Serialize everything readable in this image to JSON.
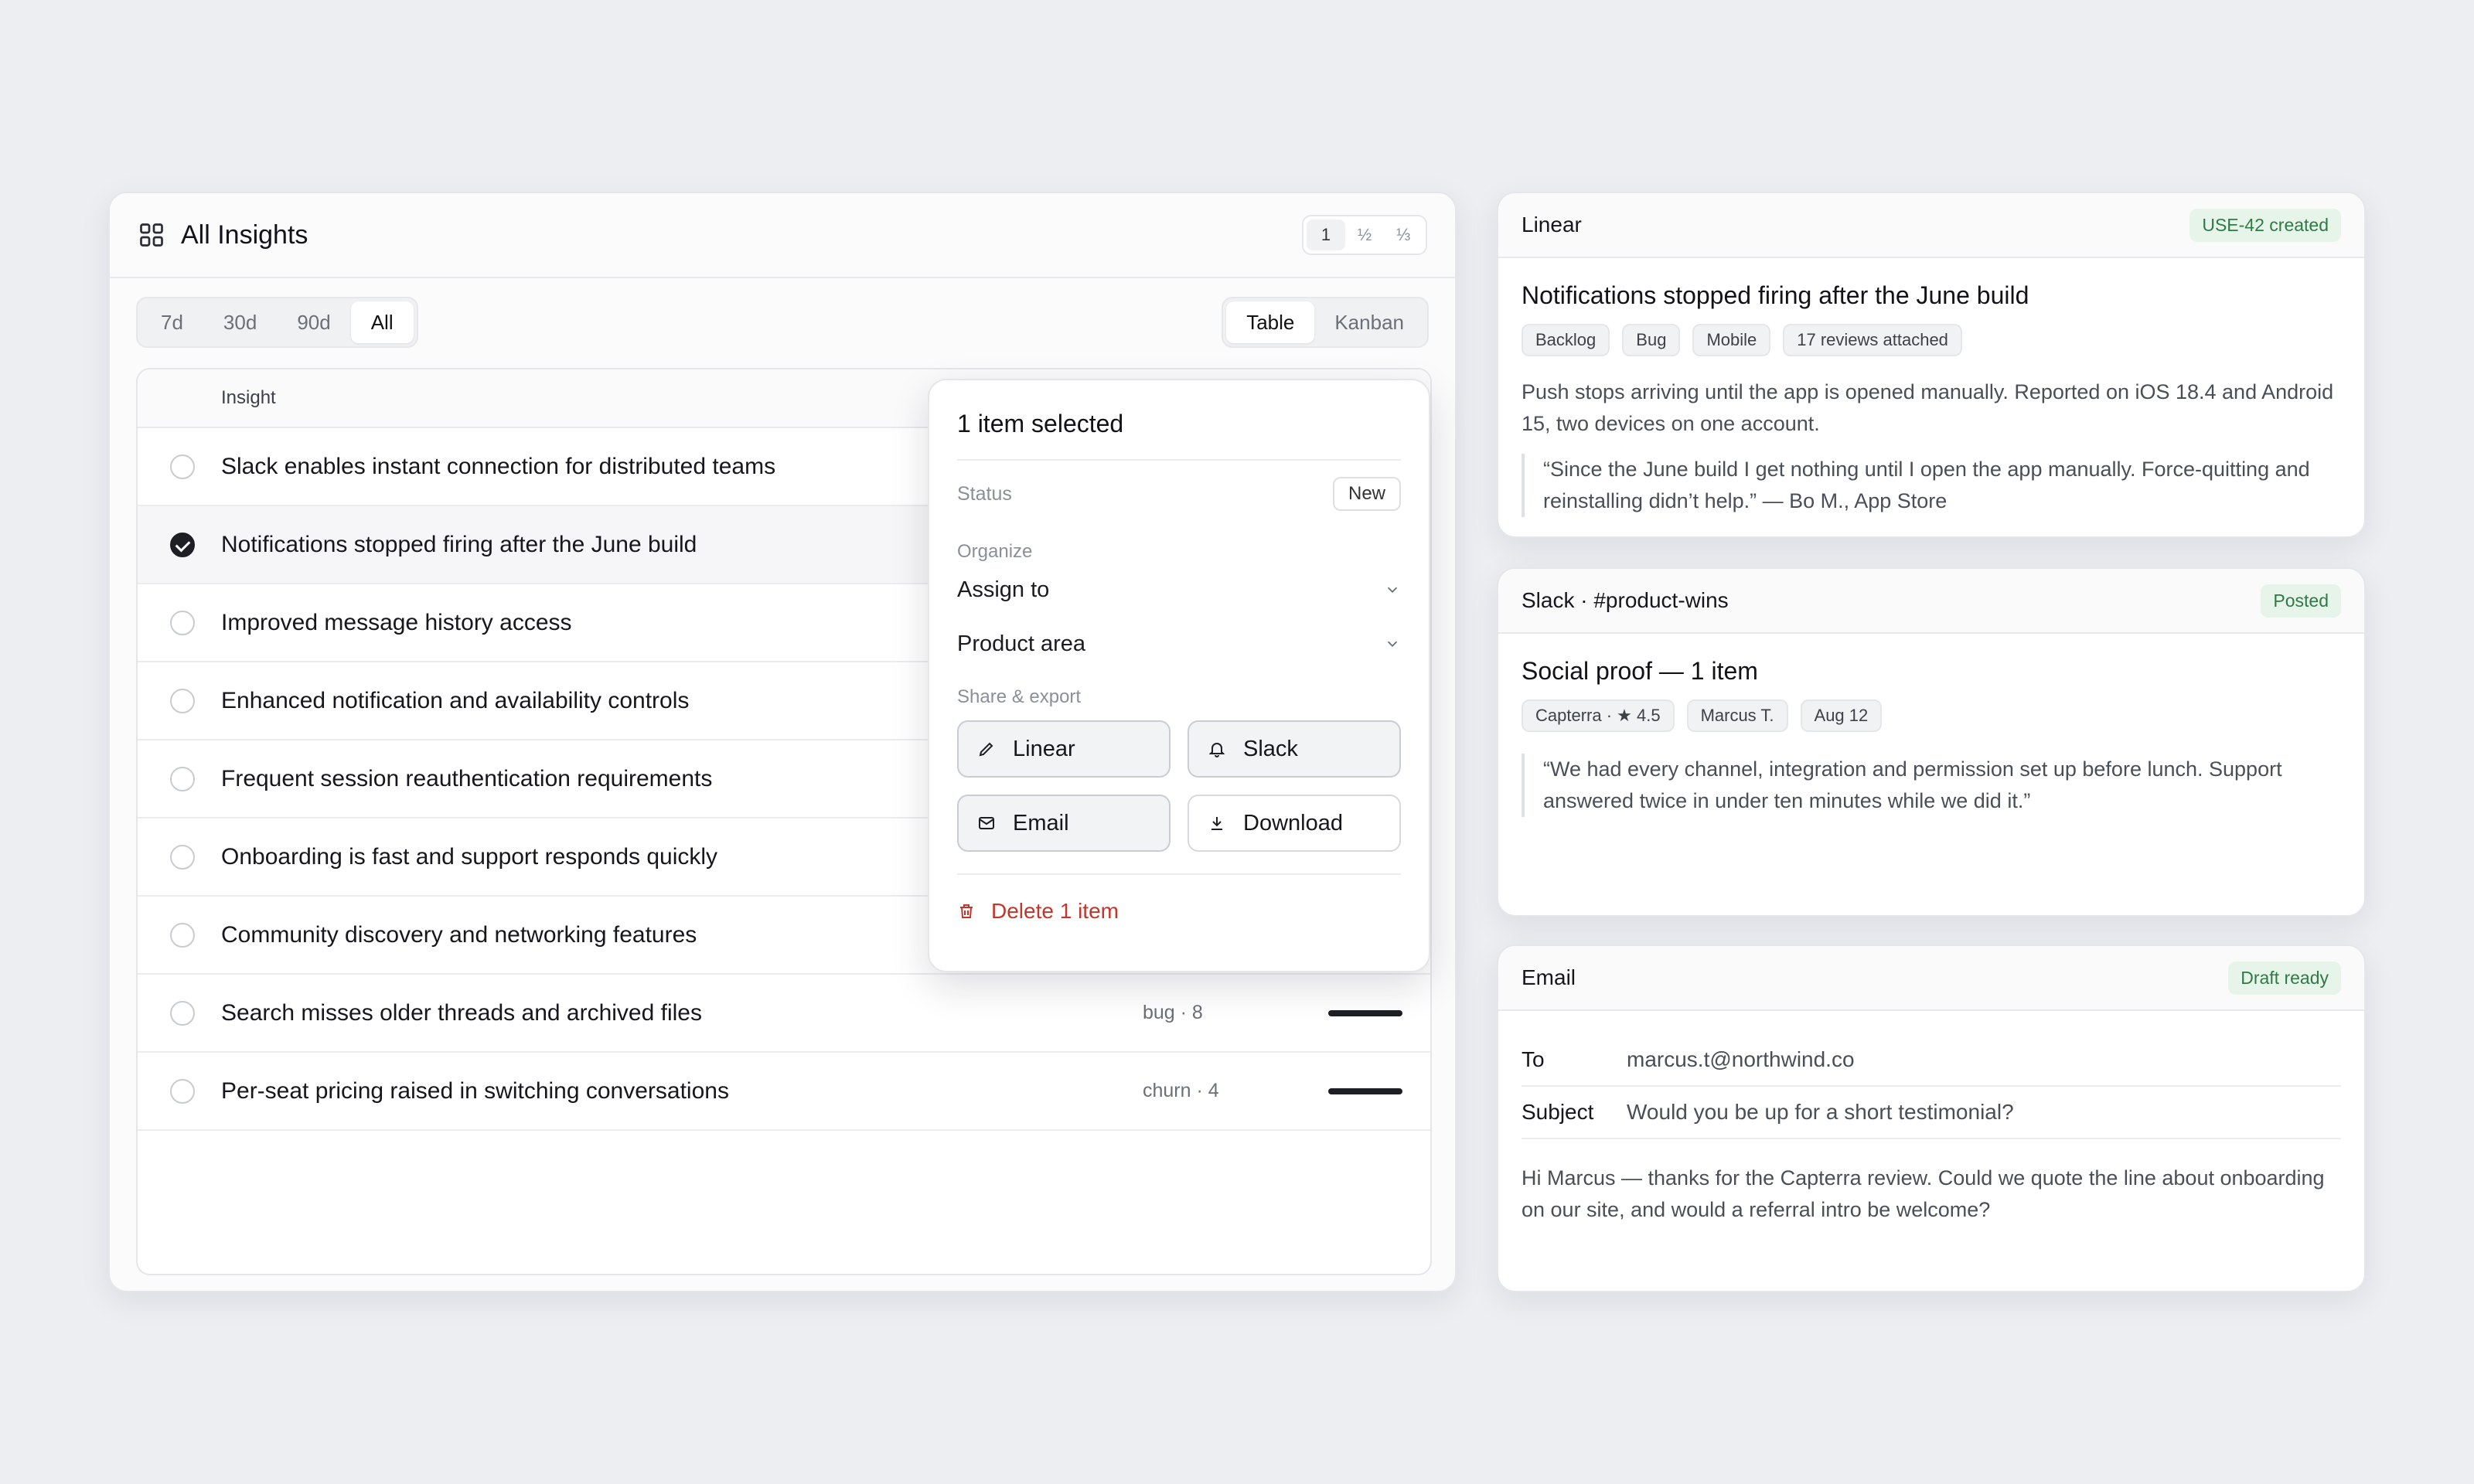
{
  "insights": {
    "title": "All Insights",
    "density_options": [
      "1",
      "½",
      "⅓"
    ],
    "density_selected": "1",
    "time_ranges": [
      "7d",
      "30d",
      "90d",
      "All"
    ],
    "time_selected": "All",
    "views": [
      "Table",
      "Kanban"
    ],
    "view_selected": "Table",
    "column_header": "Insight",
    "rows": [
      {
        "label": "Slack enables instant connection for distributed teams",
        "selected": false,
        "tag": "",
        "bar": false
      },
      {
        "label": "Notifications stopped firing after the June build",
        "selected": true,
        "tag": "",
        "bar": false
      },
      {
        "label": "Improved message history access",
        "selected": false,
        "tag": "",
        "bar": false
      },
      {
        "label": "Enhanced notification and availability controls",
        "selected": false,
        "tag": "",
        "bar": false
      },
      {
        "label": "Frequent session reauthentication requirements",
        "selected": false,
        "tag": "",
        "bar": false
      },
      {
        "label": "Onboarding is fast and support responds quickly",
        "selected": false,
        "tag": "",
        "bar": false
      },
      {
        "label": "Community discovery and networking features",
        "selected": false,
        "tag": "",
        "bar": false
      },
      {
        "label": "Search misses older threads and archived files",
        "selected": false,
        "tag": "bug · 8",
        "bar": true
      },
      {
        "label": "Per-seat pricing raised in switching conversations",
        "selected": false,
        "tag": "churn · 4",
        "bar": true
      }
    ]
  },
  "popover": {
    "title": "1 item selected",
    "status_label": "Status",
    "status_value": "New",
    "organize_label": "Organize",
    "assign_label": "Assign to",
    "area_label": "Product area",
    "share_label": "Share & export",
    "buttons": {
      "linear": "Linear",
      "slack": "Slack",
      "email": "Email",
      "download": "Download"
    },
    "delete_label": "Delete 1 item"
  },
  "linear_card": {
    "source": "Linear",
    "badge": "USE-42 created",
    "title": "Notifications stopped firing after the June build",
    "chips": [
      "Backlog",
      "Bug",
      "Mobile",
      "17 reviews attached"
    ],
    "description": "Push stops arriving until the app is opened manually. Reported on iOS 18.4 and Android 15, two devices on one account.",
    "quote": "“Since the June build I get nothing until I open the app manually. Force-quitting and reinstalling didn’t help.” — Bo M., App Store"
  },
  "slack_card": {
    "source": "Slack · #product-wins",
    "badge": "Posted",
    "title": "Social proof — 1 item",
    "chips": [
      "Capterra · ★ 4.5",
      "Marcus T.",
      "Aug 12"
    ],
    "quote": "“We had every channel, integration and permission set up before lunch. Support answered twice in under ten minutes while we did it.”"
  },
  "email_card": {
    "source": "Email",
    "badge": "Draft ready",
    "to_label": "To",
    "to_value": "marcus.t@northwind.co",
    "subject_label": "Subject",
    "subject_value": "Would you be up for a short testimonial?",
    "body": "Hi Marcus — thanks for the Capterra review. Could we quote the line about onboarding on our site, and would a referral intro be welcome?"
  }
}
